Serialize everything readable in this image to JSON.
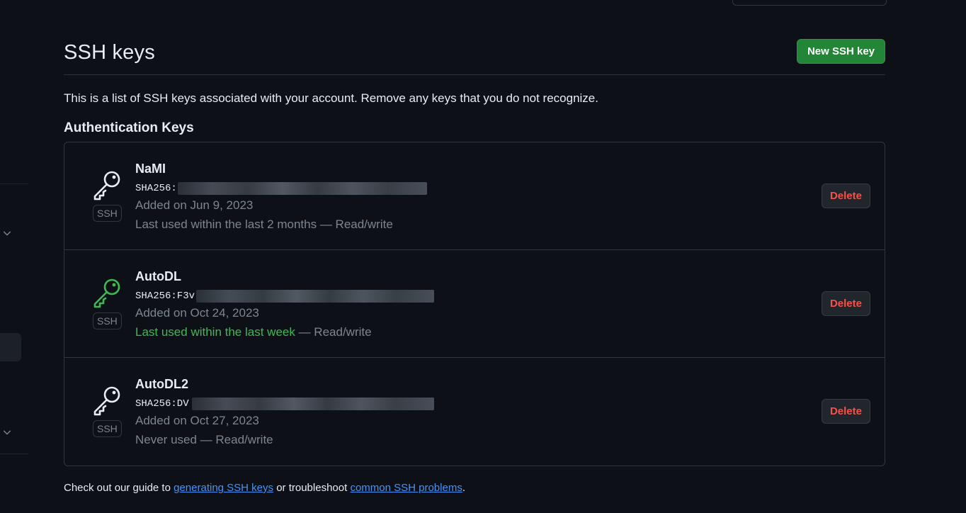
{
  "header": {
    "title": "SSH keys",
    "new_button_label": "New SSH key"
  },
  "intro_text": "This is a list of SSH keys associated with your account. Remove any keys that you do not recognize.",
  "section_title": "Authentication Keys",
  "keys": [
    {
      "title": "NaMI",
      "fingerprint": "SHA256:",
      "badge": "SSH",
      "added": "Added on Jun 9, 2023",
      "last_used": "Last used within the last 2 months",
      "access": " — Read/write",
      "delete_label": "Delete",
      "icon_color": "#e6edf3"
    },
    {
      "title": "AutoDL",
      "fingerprint": "SHA256:F3v",
      "badge": "SSH",
      "added": "Added on Oct 24, 2023",
      "last_used": "Last used within the last week",
      "access": " — Read/write",
      "delete_label": "Delete",
      "icon_color": "#3fb950"
    },
    {
      "title": "AutoDL2",
      "fingerprint": "SHA256:DV",
      "badge": "SSH",
      "added": "Added on Oct 27, 2023",
      "last_used": "Never used",
      "access": " — Read/write",
      "delete_label": "Delete",
      "icon_color": "#e6edf3"
    }
  ],
  "footer": {
    "prefix": "Check out our guide to ",
    "link1": "generating SSH keys",
    "middle": " or troubleshoot ",
    "link2": "common SSH problems",
    "suffix": "."
  },
  "colors": {
    "background": "#0d1117",
    "primary_button": "#238636",
    "danger": "#f85149",
    "recent_green": "#3fb950",
    "link": "#4493f8"
  }
}
